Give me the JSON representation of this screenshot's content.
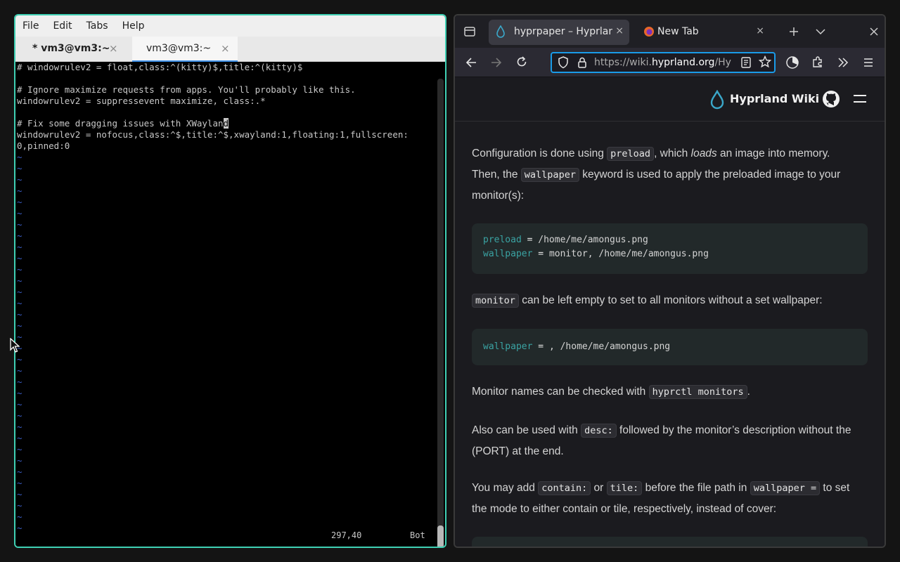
{
  "terminal": {
    "menu": [
      "File",
      "Edit",
      "Tabs",
      "Help"
    ],
    "tabs": [
      {
        "title": "* vm3@vm3:~",
        "close": "×"
      },
      {
        "title": "vm3@vm3:~",
        "close": "×"
      }
    ],
    "lines": [
      "# windowrulev2 = float,class:^(kitty)$,title:^(kitty)$",
      "",
      "# Ignore maximize requests from apps. You'll probably like this.",
      "windowrulev2 = suppressevent maximize, class:.*",
      "",
      "# Fix some dragging issues with XWaylan",
      "windowrulev2 = nofocus,class:^$,title:^$,xwayland:1,floating:1,fullscreen:",
      "0,pinned:0"
    ],
    "cursor_char": "d",
    "tilde": "~",
    "tilde_count": 34,
    "status_position": "297,40",
    "status_scroll": "Bot",
    "scroll_position": 1.0
  },
  "browser": {
    "tabs": [
      {
        "title": "hyprpaper – Hyprland",
        "close": "×"
      },
      {
        "title": "New Tab",
        "close": "×"
      }
    ],
    "url_prefix": "https://wiki.",
    "url_domain": "hyprland.org",
    "url_suffix": "/Hy",
    "wiki": {
      "site_title": "Hyprland Wiki",
      "p1": {
        "a": "Configuration is done using ",
        "code1": "preload",
        "b": ", which ",
        "em": "loads",
        "c": " an image into memory.",
        "d": "Then, the ",
        "code2": "wallpaper",
        "e": " keyword is used to apply the preloaded image to your",
        "f": "monitor(s):"
      },
      "code1": {
        "line1_kw": "preload",
        "line1_op": " = ",
        "line1_val": "/home/me/amongus.png",
        "line2_kw": "wallpaper",
        "line2_op": " = ",
        "line2_val": "monitor, /home/me/amongus.png"
      },
      "p2": {
        "code": "monitor",
        "text": " can be left empty to set to all monitors without a set wallpaper:"
      },
      "code2": {
        "kw": "wallpaper",
        "op": " = ",
        "val": ", /home/me/amongus.png"
      },
      "p3": {
        "a": "Monitor names can be checked with ",
        "code": "hyprctl monitors",
        "b": "."
      },
      "p4": {
        "a": "Also can be used with ",
        "code": "desc:",
        "b": " followed by the monitor’s description without the",
        "c": "(PORT) at the end."
      },
      "p5": {
        "a": "You may add ",
        "code1": "contain:",
        "b": " or ",
        "code2": "tile:",
        "c": " before the file path in ",
        "code3": "wallpaper =",
        "d": " to set",
        "e": "the mode to either contain or tile, respectively, instead of cover:"
      }
    }
  }
}
